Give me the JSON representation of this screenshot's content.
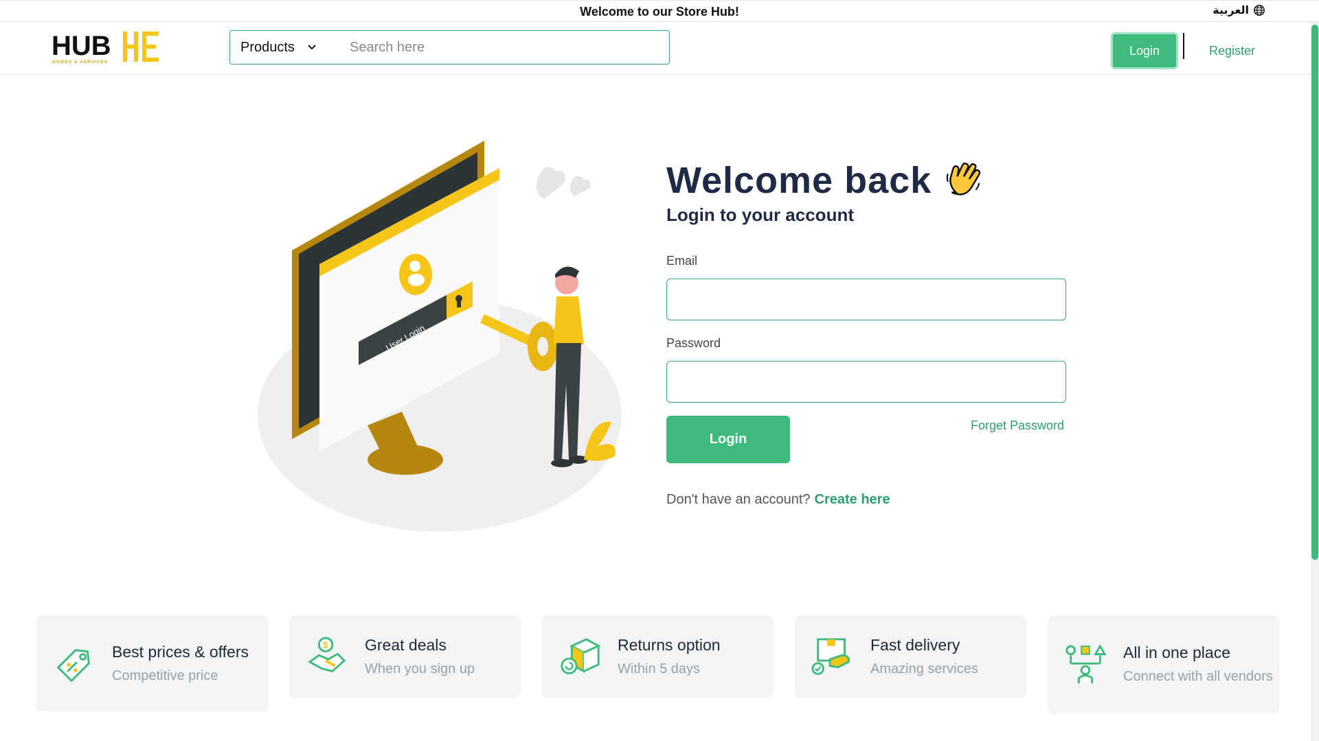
{
  "topbar": {
    "message": "Welcome to our Store Hub!",
    "language": "العربية",
    "language_icon": "globe-icon"
  },
  "header": {
    "logo_text": "HUB",
    "logo_tagline": "GOODS & SERVICES",
    "products_label": "Products",
    "search_placeholder": "Search here",
    "login_label": "Login",
    "register_label": "Register"
  },
  "login": {
    "title": "Welcome back",
    "title_icon": "waving-hand-icon",
    "subtitle": "Login to your account",
    "email_label": "Email",
    "email_value": "",
    "password_label": "Password",
    "password_value": "",
    "login_button": "Login",
    "forget_password": "Forget Password",
    "no_account_text": "Don't have an account?",
    "create_link": "Create here"
  },
  "illustration": {
    "screen_text": "User Login"
  },
  "features": [
    {
      "icon": "price-tag-icon",
      "title": "Best prices & offers",
      "subtitle": "Competitive price"
    },
    {
      "icon": "handshake-deal-icon",
      "title": "Great deals",
      "subtitle": "When you sign up"
    },
    {
      "icon": "return-box-icon",
      "title": "Returns option",
      "subtitle": "Within 5 days"
    },
    {
      "icon": "delivery-hand-icon",
      "title": "Fast delivery",
      "subtitle": "Amazing services"
    },
    {
      "icon": "vendors-network-icon",
      "title": "All in one place",
      "subtitle": "Connect with all vendors"
    }
  ],
  "colors": {
    "accent": "#3dba7c",
    "link": "#2f9e6e",
    "brand_yellow": "#f5c518",
    "dark_text": "#1f2a44"
  }
}
